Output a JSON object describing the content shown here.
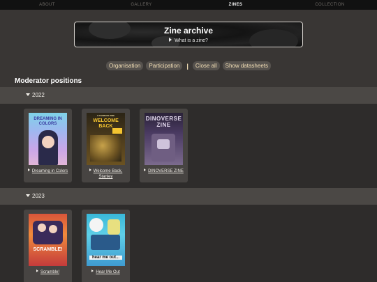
{
  "nav": {
    "items": [
      "ABOUT",
      "GALLERY",
      "ZINES",
      "COLLECTION"
    ]
  },
  "banner": {
    "title": "Zine archive",
    "subtitle": "What is a zine?"
  },
  "filters": [
    "Organisation",
    "Participation",
    "Close all",
    "Show datasheets"
  ],
  "filter_divider": "|",
  "section": {
    "title": "Moderator positions"
  },
  "years": [
    {
      "label": "2022",
      "zines": [
        {
          "title": "Dreaming in Colors",
          "cover_text": "DREAMING IN COLORS"
        },
        {
          "title": "Welcome Back, Stanley",
          "cover_text": "WELCOME BACK",
          "cover_sub": "A FANMADE ZINE"
        },
        {
          "title": "DINOVERSE ZINE",
          "cover_text": "DINOVERSE ZINE"
        }
      ]
    },
    {
      "label": "2023",
      "zines": [
        {
          "title": "Scramble!",
          "cover_text": "SCRAMBLE!"
        },
        {
          "title": "Hear Me Out",
          "cover_text": "hear me out..."
        }
      ]
    }
  ],
  "colors": {
    "background": "#393634",
    "nav_bg": "#111111",
    "pill_bg": "#56524e",
    "pill_text": "#f3dfb6",
    "year_bar": "#4b4845",
    "year_content": "#2e2c2b",
    "card_bg": "#474442"
  }
}
